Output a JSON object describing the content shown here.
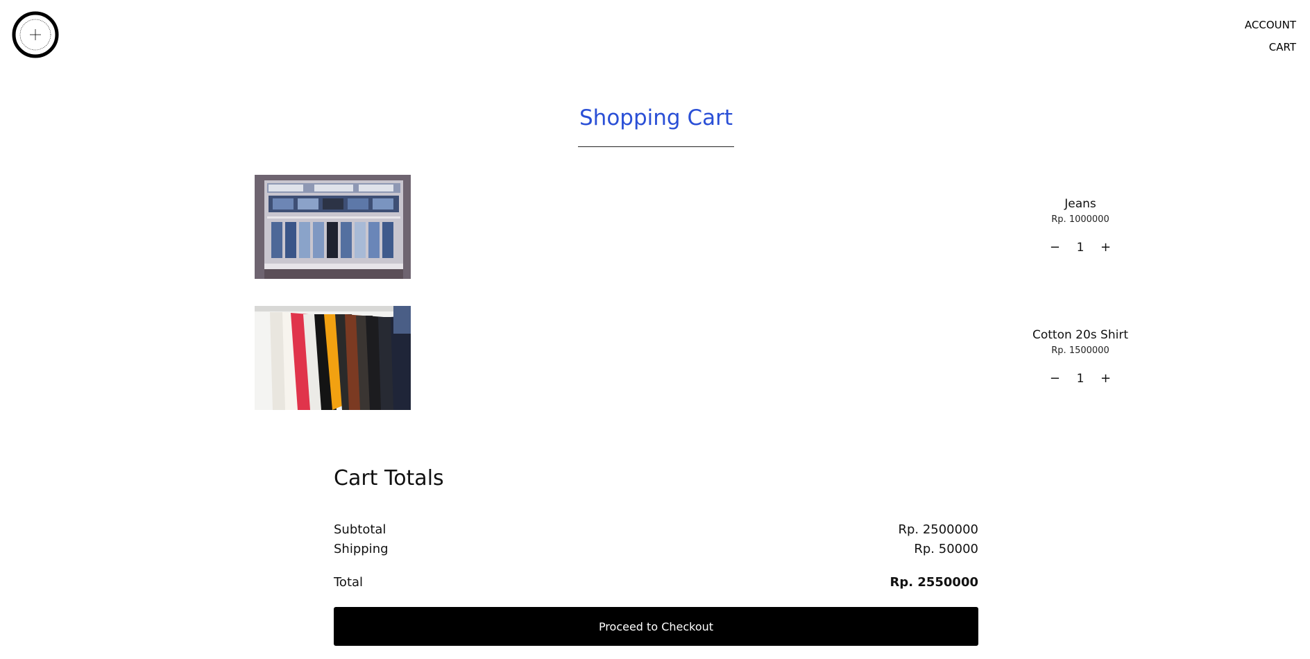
{
  "header": {
    "logo_icon": "brand-logo-circle",
    "nav": [
      {
        "label": "ACCOUNT"
      },
      {
        "label": "CART"
      }
    ]
  },
  "page": {
    "title": "Shopping Cart",
    "title_color": "#2a4fd6"
  },
  "cart": {
    "items": [
      {
        "name": "Jeans",
        "price": "Rp. 1000000",
        "quantity": "1",
        "image": "jeans-display-photo",
        "decrease_icon": "minus-icon",
        "increase_icon": "plus-icon"
      },
      {
        "name": "Cotton 20s Shirt",
        "price": "Rp. 1500000",
        "quantity": "1",
        "image": "shirts-rack-photo",
        "decrease_icon": "minus-icon",
        "increase_icon": "plus-icon"
      }
    ]
  },
  "totals": {
    "heading": "Cart Totals",
    "subtotal_label": "Subtotal",
    "subtotal_value": "Rp. 2500000",
    "shipping_label": "Shipping",
    "shipping_value": "Rp. 50000",
    "total_label": "Total",
    "total_value": "Rp. 2550000",
    "checkout_label": "Proceed to Checkout",
    "checkout_color": "#000000"
  },
  "symbols": {
    "minus": "−",
    "plus": "+"
  }
}
